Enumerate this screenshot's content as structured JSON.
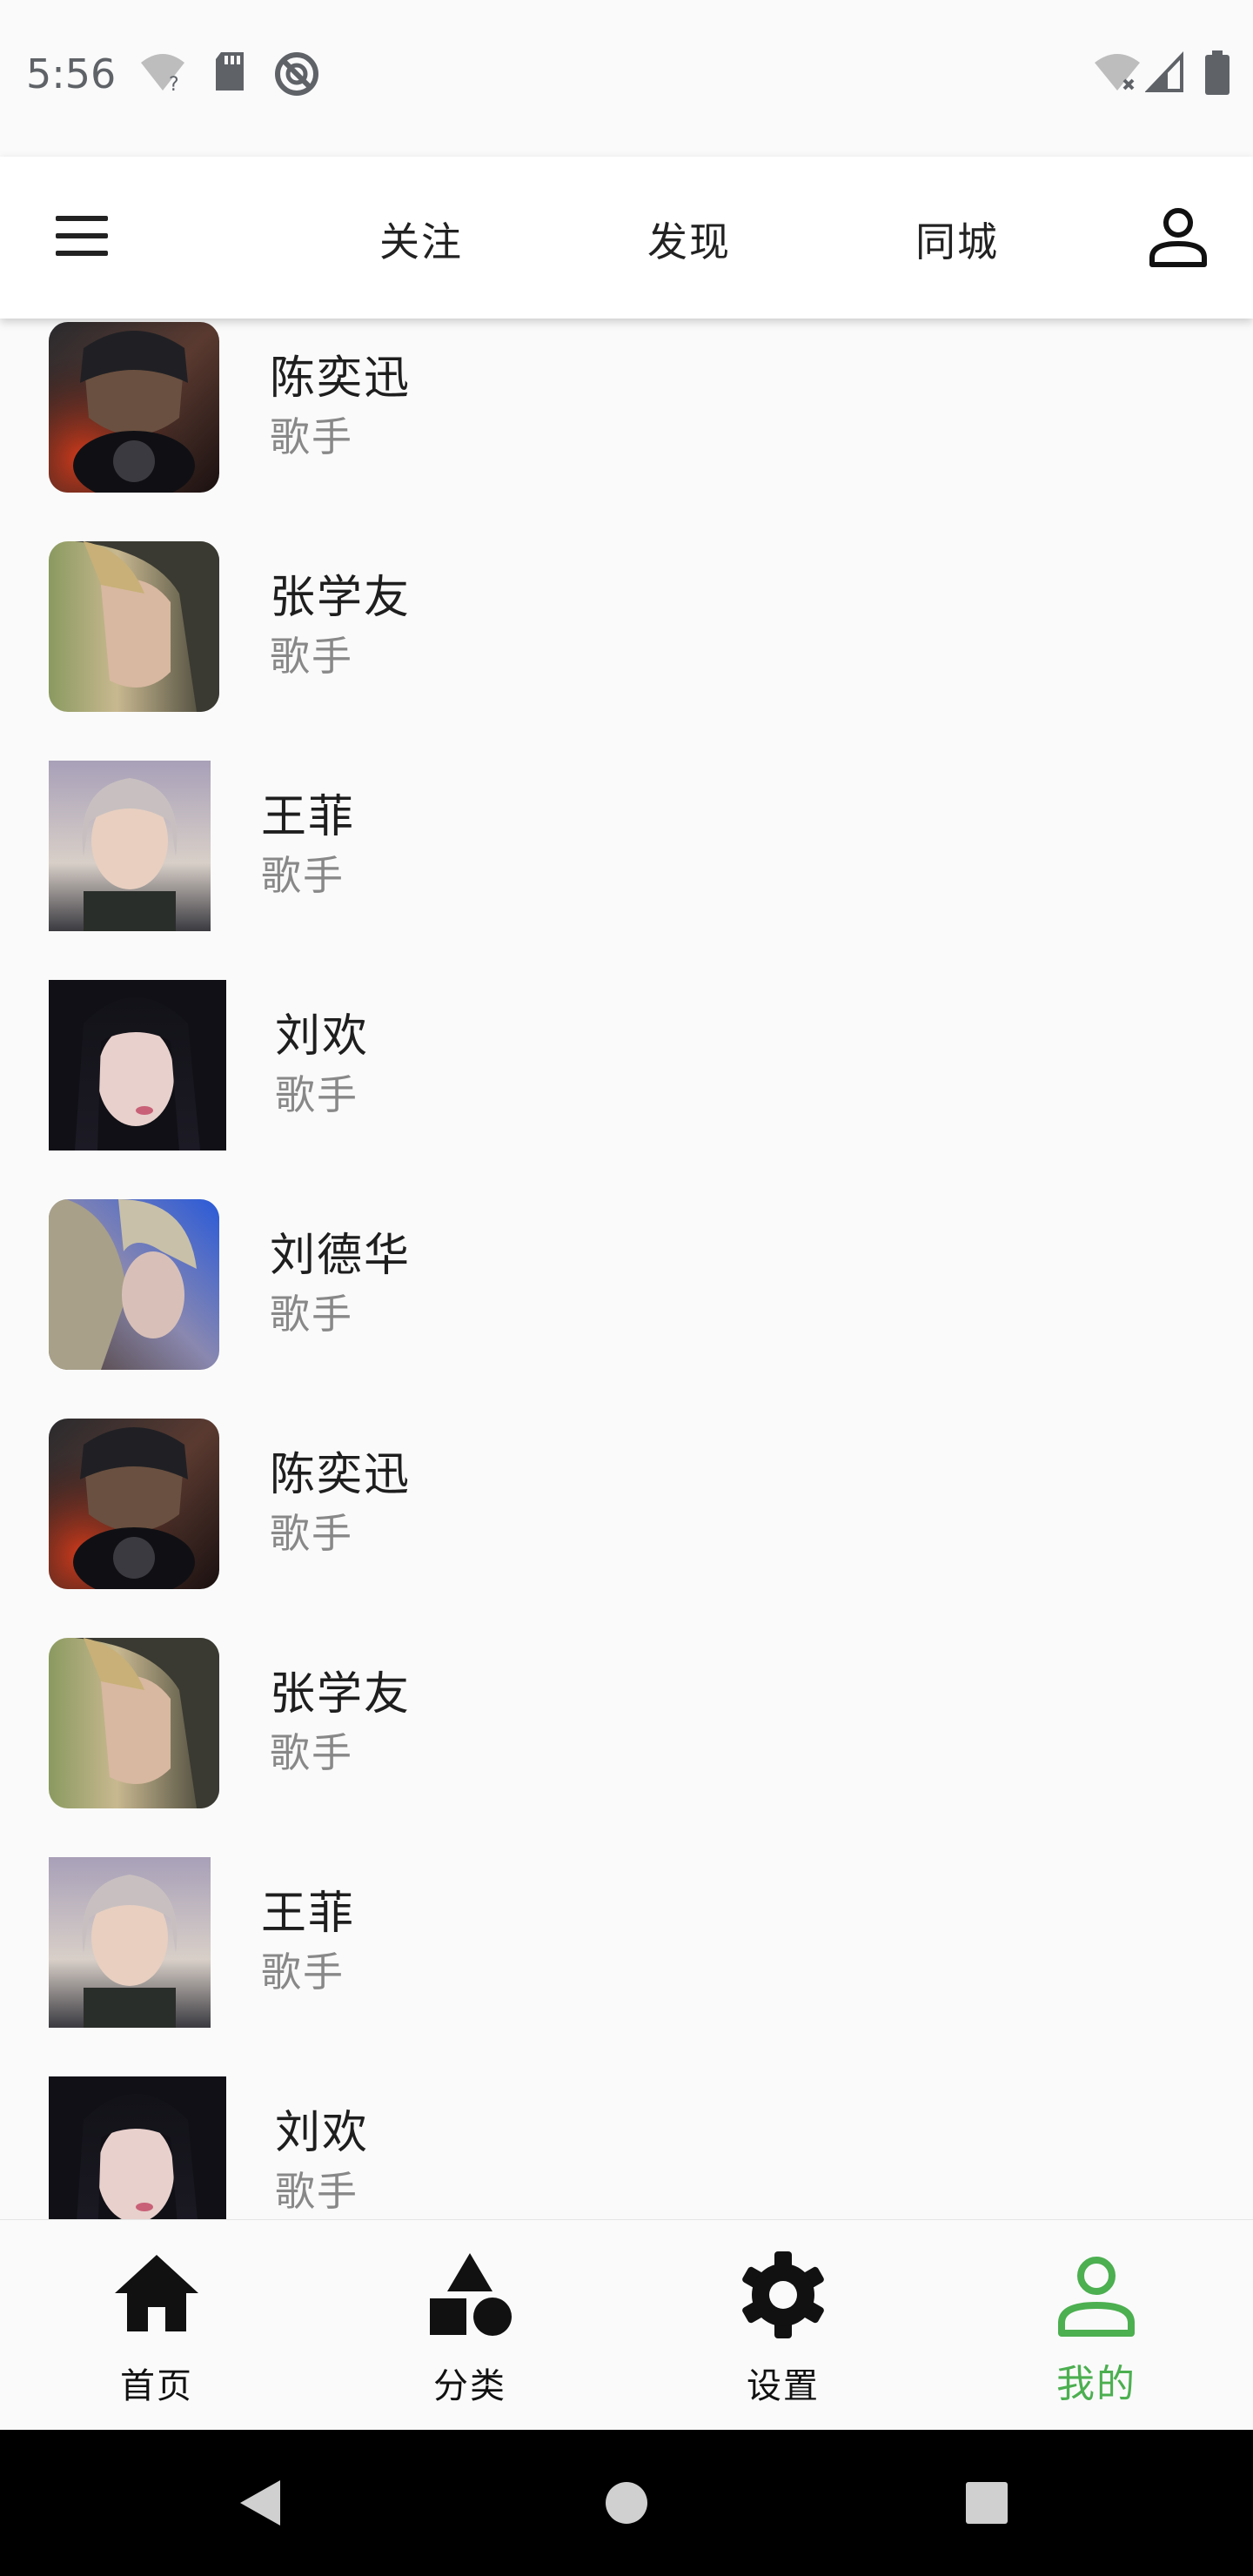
{
  "status_bar": {
    "time": "5:56",
    "left_icons": [
      "wifi-question-icon",
      "sd-card-icon",
      "do-not-disturb-icon"
    ],
    "right_icons": [
      "wifi-off-icon",
      "cell-signal-icon",
      "battery-icon"
    ]
  },
  "app_bar": {
    "menu_icon": "menu-icon",
    "tabs": [
      {
        "label": "关注"
      },
      {
        "label": "发现"
      },
      {
        "label": "同城"
      }
    ],
    "profile_icon": "person-outline-icon"
  },
  "list": {
    "items": [
      {
        "name": "陈奕迅",
        "role": "歌手"
      },
      {
        "name": "张学友",
        "role": "歌手"
      },
      {
        "name": "王菲",
        "role": "歌手"
      },
      {
        "name": "刘欢",
        "role": "歌手"
      },
      {
        "name": "刘德华",
        "role": "歌手"
      },
      {
        "name": "陈奕迅",
        "role": "歌手"
      },
      {
        "name": "张学友",
        "role": "歌手"
      },
      {
        "name": "王菲",
        "role": "歌手"
      },
      {
        "name": "刘欢",
        "role": "歌手"
      }
    ]
  },
  "bottom_nav": {
    "items": [
      {
        "label": "首页",
        "icon": "home-icon"
      },
      {
        "label": "分类",
        "icon": "category-icon"
      },
      {
        "label": "设置",
        "icon": "settings-icon"
      },
      {
        "label": "我的",
        "icon": "person-outline-icon",
        "active": true
      }
    ],
    "active_color": "#4caf50"
  },
  "system_nav": {
    "buttons": [
      "back-icon",
      "home-circle-icon",
      "recents-icon"
    ]
  }
}
